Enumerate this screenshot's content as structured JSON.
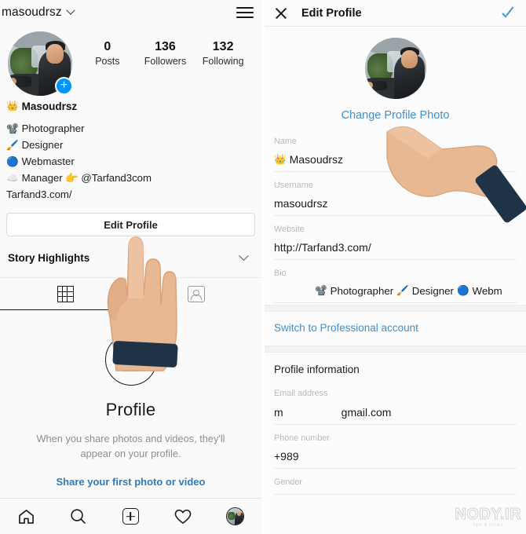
{
  "left": {
    "topbar": {
      "username": "masoudrsz",
      "menu_icon": "hamburger-icon",
      "chevron_icon": "chevron-down-icon"
    },
    "avatar": {
      "badge": "+"
    },
    "stats": [
      {
        "count": "0",
        "label": "Posts"
      },
      {
        "count": "136",
        "label": "Followers"
      },
      {
        "count": "132",
        "label": "Following"
      }
    ],
    "bio": {
      "display_name": "Masoudrsz",
      "name_emoji": "👑",
      "lines": [
        {
          "emoji": "📽️",
          "text": "Photographer"
        },
        {
          "emoji": "🖌️",
          "text": "Designer"
        },
        {
          "emoji": "🔵",
          "text": "Webmaster"
        },
        {
          "emoji": "☁️",
          "text": "Manager 👉 @Tarfand3com"
        }
      ],
      "website": "Tarfand3.com/"
    },
    "edit_button": "Edit Profile",
    "story_highlights": "Story Highlights",
    "tabs": [
      {
        "name": "grid-tab",
        "icon": "grid-icon",
        "active": true
      },
      {
        "name": "tagged-tab",
        "icon": "tagged-photos-icon",
        "active": false
      }
    ],
    "empty_state": {
      "icon": "camera-plus-icon",
      "title": "Profile",
      "text": "When you share photos and videos, they'll appear on your profile.",
      "cta": "Share your first photo or video"
    },
    "nav": [
      {
        "name": "home",
        "icon": "home-icon"
      },
      {
        "name": "search",
        "icon": "search-icon"
      },
      {
        "name": "create",
        "icon": "add-box-icon"
      },
      {
        "name": "activity",
        "icon": "heart-icon"
      },
      {
        "name": "profile",
        "icon": "profile-avatar-icon"
      }
    ]
  },
  "right": {
    "header": {
      "close_icon": "close-icon",
      "title": "Edit Profile",
      "confirm_icon": "check-icon"
    },
    "change_photo": "Change Profile Photo",
    "fields": [
      {
        "label": "Name",
        "value": "Masoudrsz",
        "emoji": "👑"
      },
      {
        "label": "Username",
        "value": "masoudrsz",
        "emoji": ""
      },
      {
        "label": "Website",
        "value": "http://Tarfand3.com/",
        "emoji": ""
      }
    ],
    "bio_field": {
      "label": "Bio",
      "parts": [
        {
          "emoji": "📽️",
          "text": "Photographer"
        },
        {
          "emoji": "🖌️",
          "text": "Designer"
        },
        {
          "emoji": "🔵",
          "text": "Webm"
        }
      ]
    },
    "switch_account": "Switch to Professional account",
    "profile_information": "Profile information",
    "info_fields": [
      {
        "label": "Email address",
        "value_prefix": "m",
        "value_suffix": "gmail.com",
        "redacted": true
      },
      {
        "label": "Phone number",
        "value_prefix": "+989",
        "value_suffix": "",
        "redacted": false
      }
    ],
    "gender_label": "Gender"
  },
  "watermark": {
    "main": "NODY.IR",
    "sub": "tips & tricks"
  }
}
